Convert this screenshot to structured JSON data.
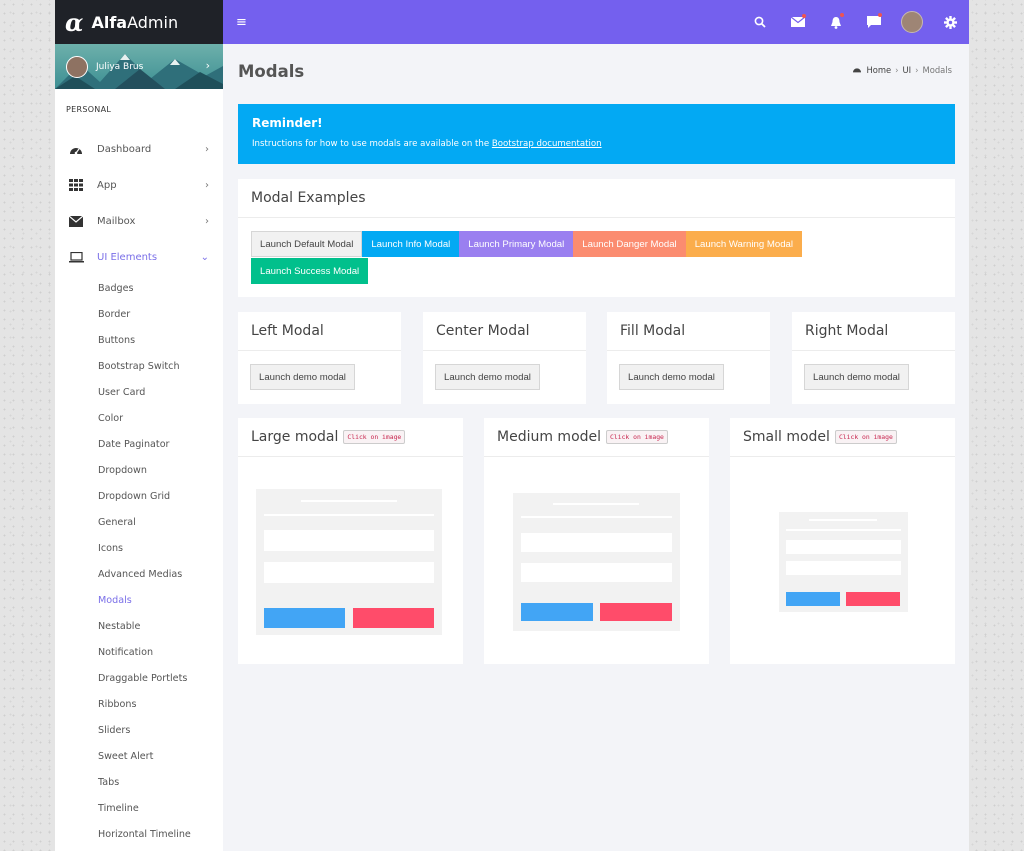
{
  "logo": {
    "bold": "Alfa",
    "light": "Admin"
  },
  "user": {
    "name": "Juliya Brus"
  },
  "sidebar": {
    "section": "PERSONAL",
    "items": [
      {
        "label": "Dashboard"
      },
      {
        "label": "App"
      },
      {
        "label": "Mailbox"
      },
      {
        "label": "UI Elements"
      }
    ],
    "sub_items": [
      "Badges",
      "Border",
      "Buttons",
      "Bootstrap Switch",
      "User Card",
      "Color",
      "Date Paginator",
      "Dropdown",
      "Dropdown Grid",
      "General",
      "Icons",
      "Advanced Medias",
      "Modals",
      "Nestable",
      "Notification",
      "Draggable Portlets",
      "Ribbons",
      "Sliders",
      "Sweet Alert",
      "Tabs",
      "Timeline",
      "Horizontal Timeline"
    ]
  },
  "page": {
    "title": "Modals"
  },
  "breadcrumb": {
    "home": "Home",
    "ui": "UI",
    "current": "Modals"
  },
  "alert": {
    "title": "Reminder!",
    "text": "Instructions for how to use modals are available on the",
    "link": "Bootstrap documentation"
  },
  "examples": {
    "title": "Modal Examples",
    "buttons": [
      "Launch Default Modal",
      "Launch Info Modal",
      "Launch Primary Modal",
      "Launch Danger Modal",
      "Launch Warning Modal",
      "Launch Success Modal"
    ]
  },
  "position_cards": [
    {
      "title": "Left Modal",
      "button": "Launch demo modal"
    },
    {
      "title": "Center Modal",
      "button": "Launch demo modal"
    },
    {
      "title": "Fill Modal",
      "button": "Launch demo modal"
    },
    {
      "title": "Right Modal",
      "button": "Launch demo modal"
    }
  ],
  "size_cards": [
    {
      "title": "Large modal",
      "tag": "Click on image"
    },
    {
      "title": "Medium model",
      "tag": "Click on image"
    },
    {
      "title": "Small model",
      "tag": "Click on image"
    }
  ],
  "colors": {
    "topbar": "#7460ee",
    "accent": "#7a6fe8",
    "info": "#03a9f3"
  }
}
